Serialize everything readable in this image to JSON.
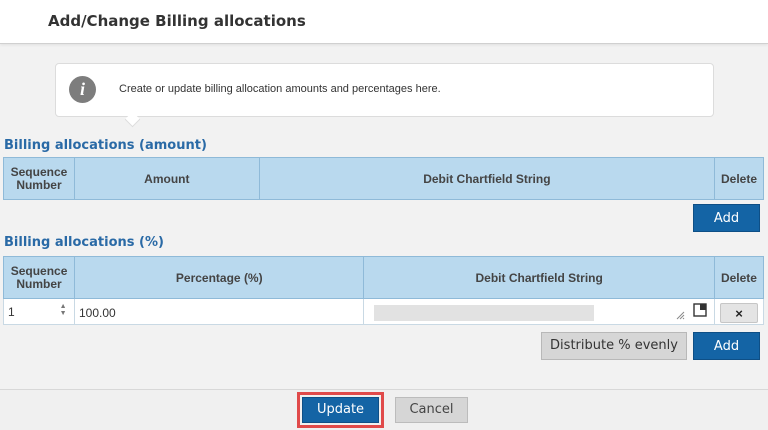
{
  "dialog": {
    "title": "Add/Change Billing allocations",
    "info_text": "Create or update billing allocation amounts and percentages here.",
    "info_icon": "info-icon"
  },
  "amount_section": {
    "title": "Billing allocations (amount)",
    "columns": {
      "sequence_line1": "Sequence",
      "sequence_line2": "Number",
      "amount": "Amount",
      "chartfield": "Debit Chartfield String",
      "delete": "Delete"
    },
    "add_label": "Add"
  },
  "percent_section": {
    "title": "Billing allocations (%)",
    "columns": {
      "sequence_line1": "Sequence",
      "sequence_line2": "Number",
      "percentage": "Percentage (%)",
      "chartfield": "Debit Chartfield String",
      "delete": "Delete"
    },
    "rows": [
      {
        "sequence": "1",
        "percentage": "100.00",
        "delete_label": "×"
      }
    ],
    "distribute_label": "Distribute % evenly",
    "add_label": "Add"
  },
  "footer": {
    "update_label": "Update",
    "cancel_label": "Cancel"
  },
  "colors": {
    "accent": "#1464a5",
    "header_fill": "#b9d9ee",
    "section_title": "#2a6aa6",
    "highlight": "#e04a4a"
  }
}
